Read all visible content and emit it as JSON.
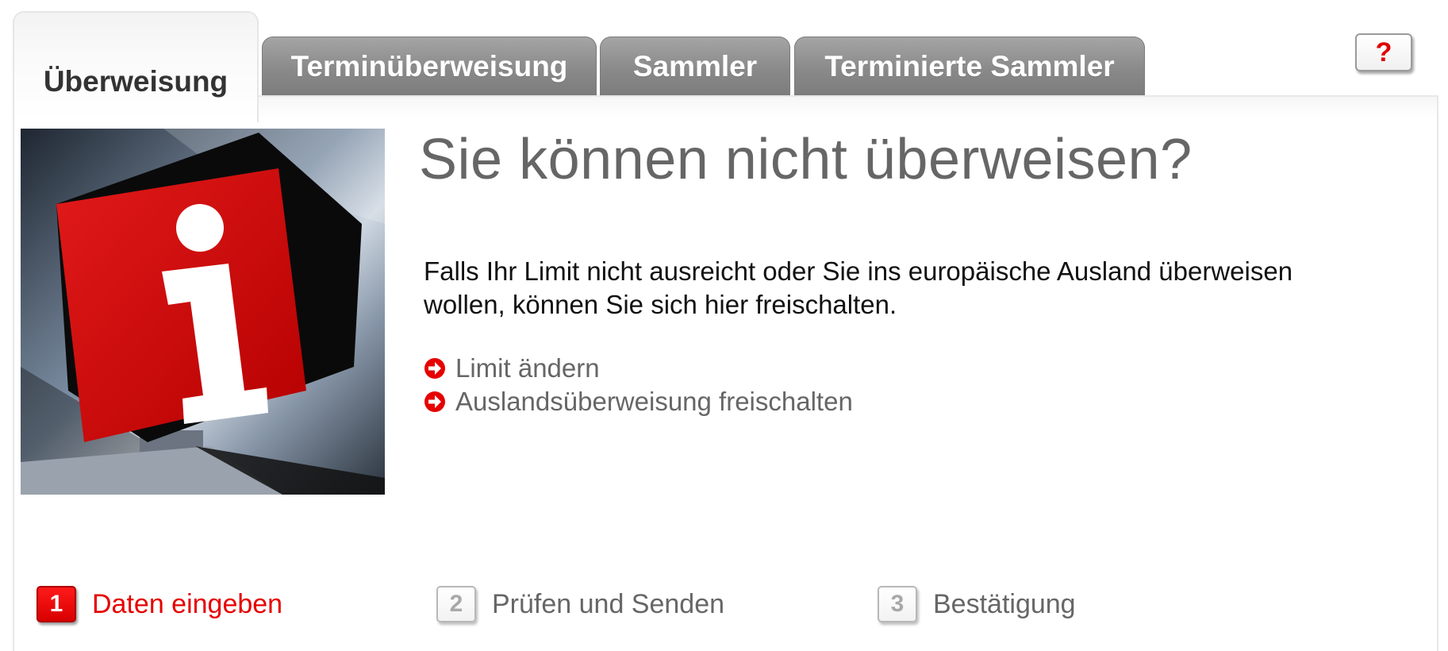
{
  "tabs": [
    {
      "label": "Überweisung",
      "active": true
    },
    {
      "label": "Terminüberweisung",
      "active": false
    },
    {
      "label": "Sammler",
      "active": false
    },
    {
      "label": "Terminierte Sammler",
      "active": false
    }
  ],
  "help": {
    "label": "?",
    "icon": "help-question-icon"
  },
  "info_image": {
    "icon": "information-cube-icon",
    "glyph": "i"
  },
  "headline": "Sie können nicht überweisen?",
  "description": "Falls Ihr Limit nicht ausreicht oder Sie ins europäische Ausland überweisen wollen, können Sie sich hier freischalten.",
  "links": [
    {
      "label": "Limit ändern",
      "icon": "arrow-right-circle-icon"
    },
    {
      "label": "Auslandsüberweisung freischalten",
      "icon": "arrow-right-circle-icon"
    }
  ],
  "steps": [
    {
      "number": "1",
      "label": "Daten eingeben",
      "active": true
    },
    {
      "number": "2",
      "label": "Prüfen und Senden",
      "active": false
    },
    {
      "number": "3",
      "label": "Bestätigung",
      "active": false
    }
  ],
  "colors": {
    "accent_red": "#e60000",
    "tab_gray": "#8a8a8a",
    "text_gray": "#666666"
  }
}
